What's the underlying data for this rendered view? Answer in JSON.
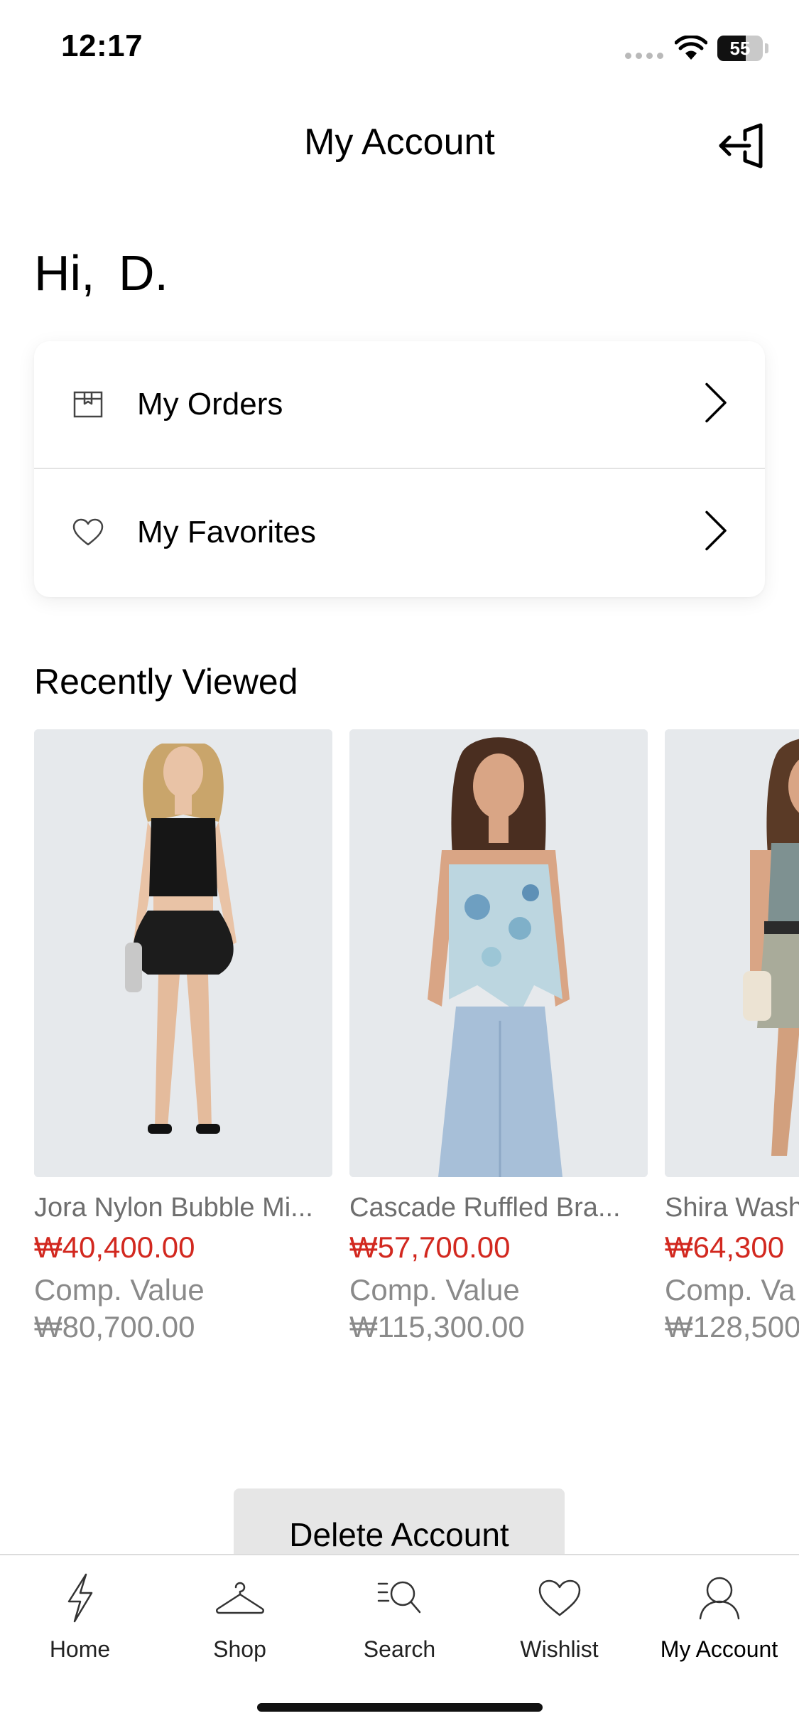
{
  "status_bar": {
    "time": "12:17",
    "battery": "55"
  },
  "header": {
    "title": "My Account",
    "logout_icon": "logout-icon"
  },
  "greeting": "Hi,  D.",
  "menu": {
    "items": [
      {
        "label": "My Orders",
        "icon": "box-icon"
      },
      {
        "label": "My Favorites",
        "icon": "heart-icon"
      }
    ]
  },
  "recently_viewed": {
    "title": "Recently Viewed",
    "items": [
      {
        "name": "Jora Nylon Bubble Mi...",
        "price": "₩40,400.00",
        "comp_label": "Comp. Value",
        "comp_value": "₩80,700.00"
      },
      {
        "name": "Cascade Ruffled Bra...",
        "price": "₩57,700.00",
        "comp_label": "Comp. Value",
        "comp_value": "₩115,300.00"
      },
      {
        "name": "Shira Wash",
        "price": "₩64,300",
        "comp_label": "Comp. Va",
        "comp_value": "₩128,500"
      }
    ]
  },
  "delete_account_label": "Delete Account",
  "tabs": [
    {
      "label": "Home",
      "icon": "lightning-icon"
    },
    {
      "label": "Shop",
      "icon": "hanger-icon"
    },
    {
      "label": "Search",
      "icon": "search-icon"
    },
    {
      "label": "Wishlist",
      "icon": "heart-icon"
    },
    {
      "label": "My Account",
      "icon": "user-icon"
    }
  ],
  "colors": {
    "price_red": "#d2281f",
    "muted_text": "#8a8a8a",
    "image_bg": "#e6e9ec"
  }
}
